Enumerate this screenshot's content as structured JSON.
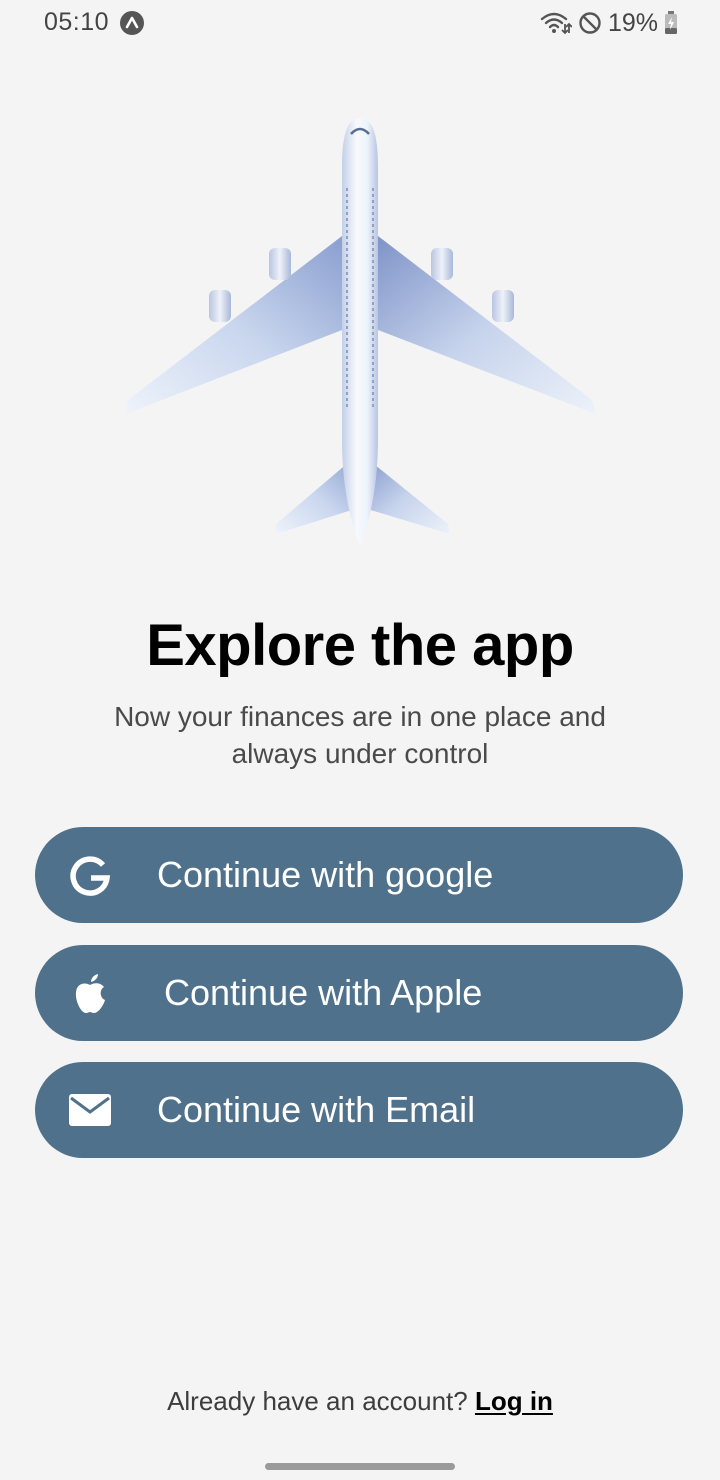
{
  "status_bar": {
    "time": "05:10",
    "battery_percent": "19%",
    "icons": [
      "auto-sync-icon",
      "wifi-icon",
      "do-not-disturb-icon",
      "battery-charging-icon"
    ]
  },
  "hero": {
    "icon": "airplane-icon"
  },
  "onboarding": {
    "title": "Explore the app",
    "subtitle": "Now your finances are in one place and always under control"
  },
  "auth_buttons": [
    {
      "label": "Continue with google",
      "icon": "google-icon"
    },
    {
      "label": "Continue with Apple",
      "icon": "apple-icon"
    },
    {
      "label": "Continue with Email",
      "icon": "mail-icon"
    }
  ],
  "footer": {
    "prompt": "Already have an account?",
    "login_label": "Log in"
  },
  "colors": {
    "background": "#f4f4f4",
    "button": "#4f718b",
    "button_text": "#ffffff",
    "title": "#000000",
    "subtitle": "#4a4a4a"
  }
}
